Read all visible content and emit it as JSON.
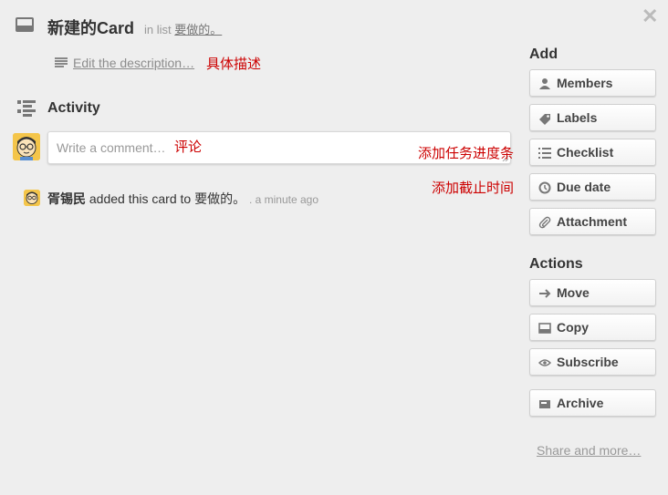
{
  "header": {
    "card_title": "新建的Card",
    "in_list_prefix": "in list",
    "list_name": "要做的。",
    "close_symbol": "✕"
  },
  "description": {
    "link_text": "Edit the description…",
    "note": "具体描述"
  },
  "activity": {
    "title": "Activity",
    "comment_placeholder": "Write a comment…",
    "comment_note": "评论",
    "entry": {
      "user": "胥锡民",
      "text": " added this card to 要做的。",
      "time": ". a minute ago"
    }
  },
  "annotations": {
    "checklist_note": "添加任务进度条",
    "due_note": "添加截止时间"
  },
  "sidebar": {
    "add_title": "Add",
    "add_buttons": [
      {
        "label": "Members",
        "icon": "person-icon"
      },
      {
        "label": "Labels",
        "icon": "tag-icon"
      },
      {
        "label": "Checklist",
        "icon": "list-icon"
      },
      {
        "label": "Due date",
        "icon": "clock-icon"
      },
      {
        "label": "Attachment",
        "icon": "paperclip-icon"
      }
    ],
    "actions_title": "Actions",
    "action_buttons": [
      {
        "label": "Move",
        "icon": "arrow-right-icon"
      },
      {
        "label": "Copy",
        "icon": "card-icon"
      },
      {
        "label": "Subscribe",
        "icon": "eye-icon"
      },
      {
        "label": "Archive",
        "icon": "archive-icon"
      }
    ],
    "share_link": "Share and more…"
  }
}
